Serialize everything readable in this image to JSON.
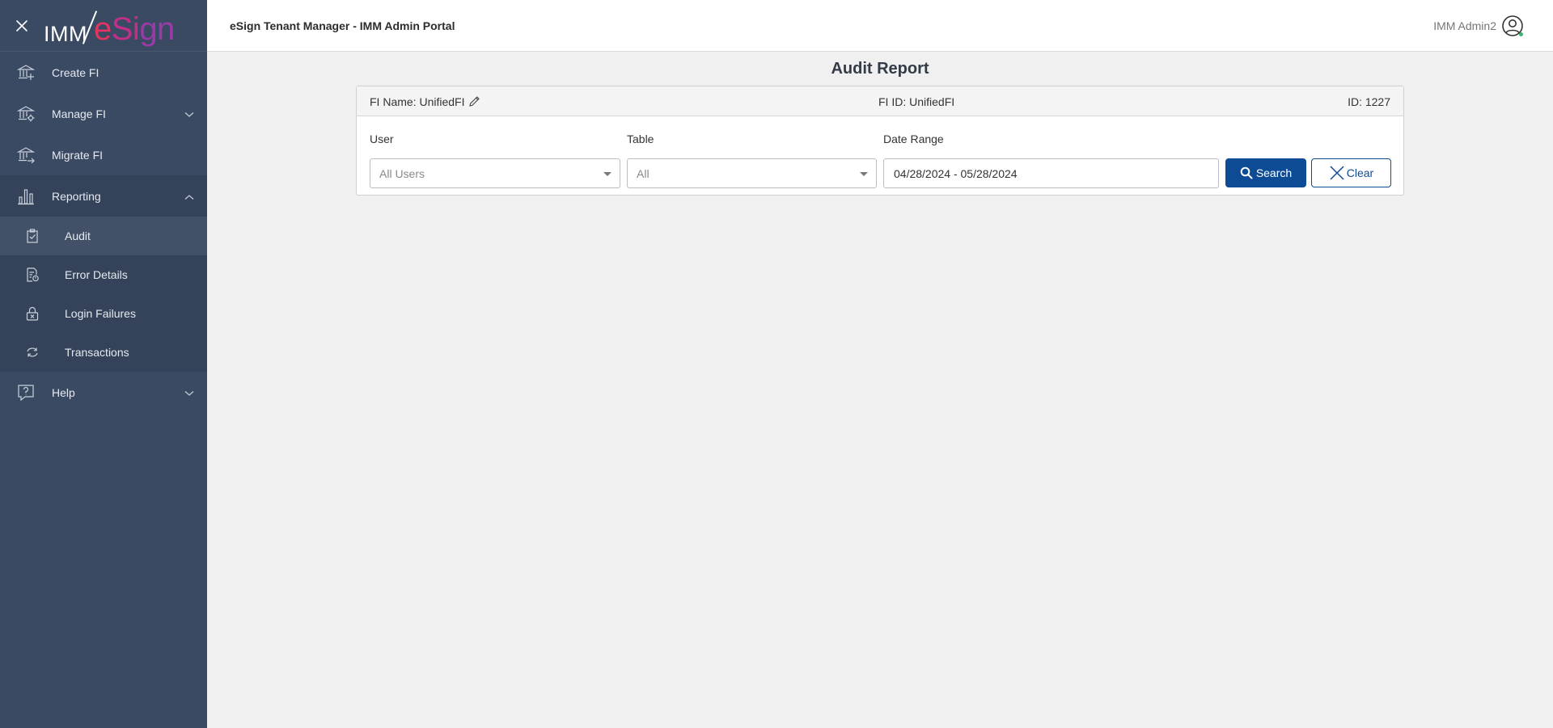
{
  "brand": {
    "logo_part1": "IMM",
    "logo_part2_a": "e",
    "logo_part2_b": "Si",
    "logo_part2_c": "gn"
  },
  "header": {
    "title": "eSign Tenant Manager - IMM Admin Portal",
    "user_name": "IMM Admin2"
  },
  "sidebar": {
    "items": [
      {
        "label": "Create FI",
        "icon": "bank-plus-icon"
      },
      {
        "label": "Manage FI",
        "icon": "bank-gear-icon",
        "expanded": false
      },
      {
        "label": "Migrate FI",
        "icon": "bank-arrow-icon"
      },
      {
        "label": "Reporting",
        "icon": "bar-chart-icon",
        "expanded": true
      },
      {
        "label": "Help",
        "icon": "question-bubble-icon",
        "expanded": false
      }
    ],
    "reporting_sub": [
      {
        "label": "Audit",
        "icon": "clipboard-check-icon",
        "active": true
      },
      {
        "label": "Error Details",
        "icon": "document-error-icon"
      },
      {
        "label": "Login Failures",
        "icon": "lock-x-icon"
      },
      {
        "label": "Transactions",
        "icon": "cycle-arrows-icon"
      }
    ]
  },
  "page": {
    "title": "Audit Report"
  },
  "card": {
    "fi_name": "FI Name: UnifiedFI",
    "fi_id": "FI ID: UnifiedFI",
    "id": "ID: 1227"
  },
  "filters": {
    "user_label": "User",
    "user_value": "All Users",
    "table_label": "Table",
    "table_value": "All",
    "date_label": "Date Range",
    "date_value": "04/28/2024 - 05/28/2024",
    "search_label": "Search",
    "clear_label": "Clear"
  },
  "colors": {
    "sidebar_bg": "#3a4a63",
    "primary": "#0d4c94",
    "brand_pink": "#e2345f",
    "brand_purple": "#9a3aa7"
  }
}
